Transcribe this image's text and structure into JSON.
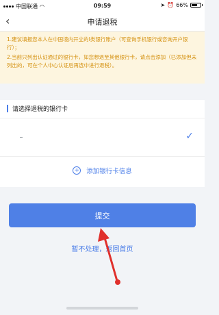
{
  "status_bar": {
    "carrier": "中国联通",
    "time": "09:59",
    "battery": "66%",
    "battery_level": 0.66
  },
  "navbar": {
    "title": "申请退税"
  },
  "notice": {
    "line1": "1.建议填报您本人在中国境内开立的Ⅰ类银行账户（可查询手机银行或咨询开户银行）；",
    "line2": "2.当前只列出认证通过的银行卡，如您想退至其他银行卡，请点击添加（已添加但未列出的，可在个人中心认证后再选中进行退税）。"
  },
  "bank_section": {
    "heading": "请选择退税的银行卡",
    "add_label": "添加银行卡信息"
  },
  "actions": {
    "submit_label": "提交",
    "skip_label": "暂不处理，返回首页"
  },
  "colors": {
    "accent": "#4a7de8",
    "notice_bg": "#fdf5df",
    "notice_text": "#d4900e",
    "annotation": "#e0302c"
  }
}
